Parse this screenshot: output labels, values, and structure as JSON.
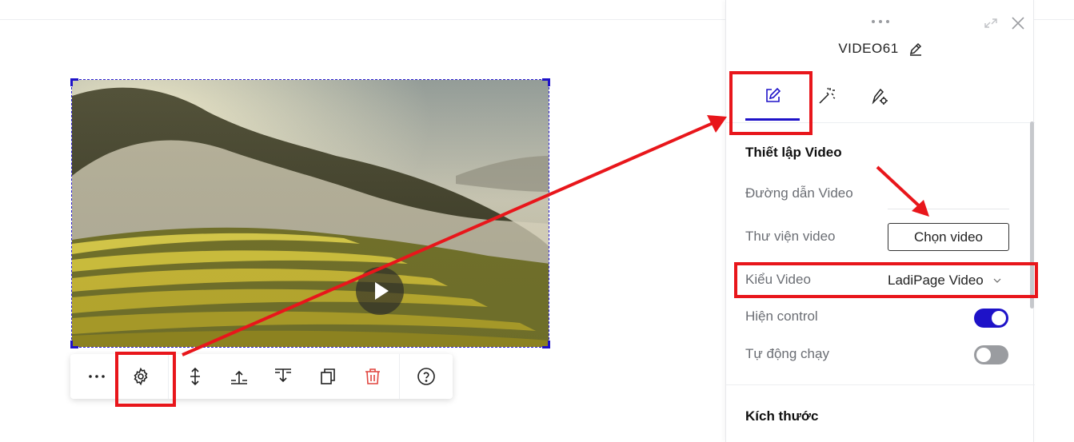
{
  "panel": {
    "element_name": "VIDEO61",
    "tabs": [
      {
        "name": "design",
        "icon": "edit-icon",
        "active": true
      },
      {
        "name": "effects",
        "icon": "magic-wand-icon",
        "active": false
      },
      {
        "name": "settings",
        "icon": "pen-gear-icon",
        "active": false
      }
    ],
    "video_settings": {
      "title": "Thiết lập Video",
      "url_label": "Đường dẫn Video",
      "url_value": "",
      "library_label": "Thư viện video",
      "library_button": "Chọn video",
      "type_label": "Kiểu Video",
      "type_value": "LadiPage Video",
      "controls_label": "Hiện control",
      "controls_on": true,
      "autoplay_label": "Tự động chạy",
      "autoplay_on": false
    },
    "size_title": "Kích thước"
  },
  "toolbar": {
    "buttons": [
      "more-icon",
      "gear-icon",
      "height-icon",
      "align-top-icon",
      "align-bottom-icon",
      "duplicate-icon",
      "trash-icon",
      "help-icon"
    ]
  },
  "colors": {
    "accent": "#1e12c8",
    "annotation": "#e8161b",
    "delete": "#e0453f",
    "toggle_off": "#9a9ca0"
  }
}
